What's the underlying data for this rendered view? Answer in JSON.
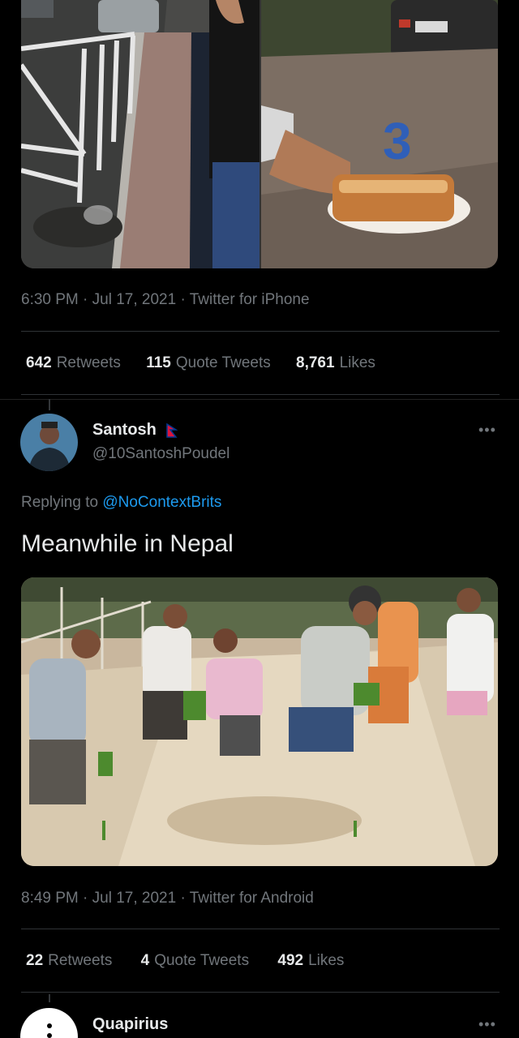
{
  "tweet1": {
    "timestamp": "6:30 PM · Jul 17, 2021 · Twitter for iPhone",
    "stats": [
      {
        "count": "642",
        "label": "Retweets"
      },
      {
        "count": "115",
        "label": "Quote Tweets"
      },
      {
        "count": "8,761",
        "label": "Likes"
      }
    ],
    "image_text": {
      "badge_number": "3"
    }
  },
  "tweet2": {
    "author_name": "Santosh",
    "author_handle": "@10SantoshPoudel",
    "replying_prefix": "Replying to",
    "replying_handle": "@NoContextBrits",
    "text": "Meanwhile in Nepal",
    "timestamp": "8:49 PM · Jul 17, 2021 · Twitter for Android",
    "stats": [
      {
        "count": "22",
        "label": "Retweets"
      },
      {
        "count": "4",
        "label": "Quote Tweets"
      },
      {
        "count": "492",
        "label": "Likes"
      }
    ]
  },
  "tweet3": {
    "author_name": "Quapirius"
  },
  "icons": {
    "more": "more-horizontal-icon",
    "flag": "nepal-flag-icon"
  },
  "colors": {
    "background": "#000000",
    "primary_text": "#e7e9ea",
    "secondary_text": "#71767b",
    "link": "#1d9bf0",
    "divider": "#2f3336",
    "flag_red": "#dc143c",
    "flag_blue": "#003893"
  }
}
